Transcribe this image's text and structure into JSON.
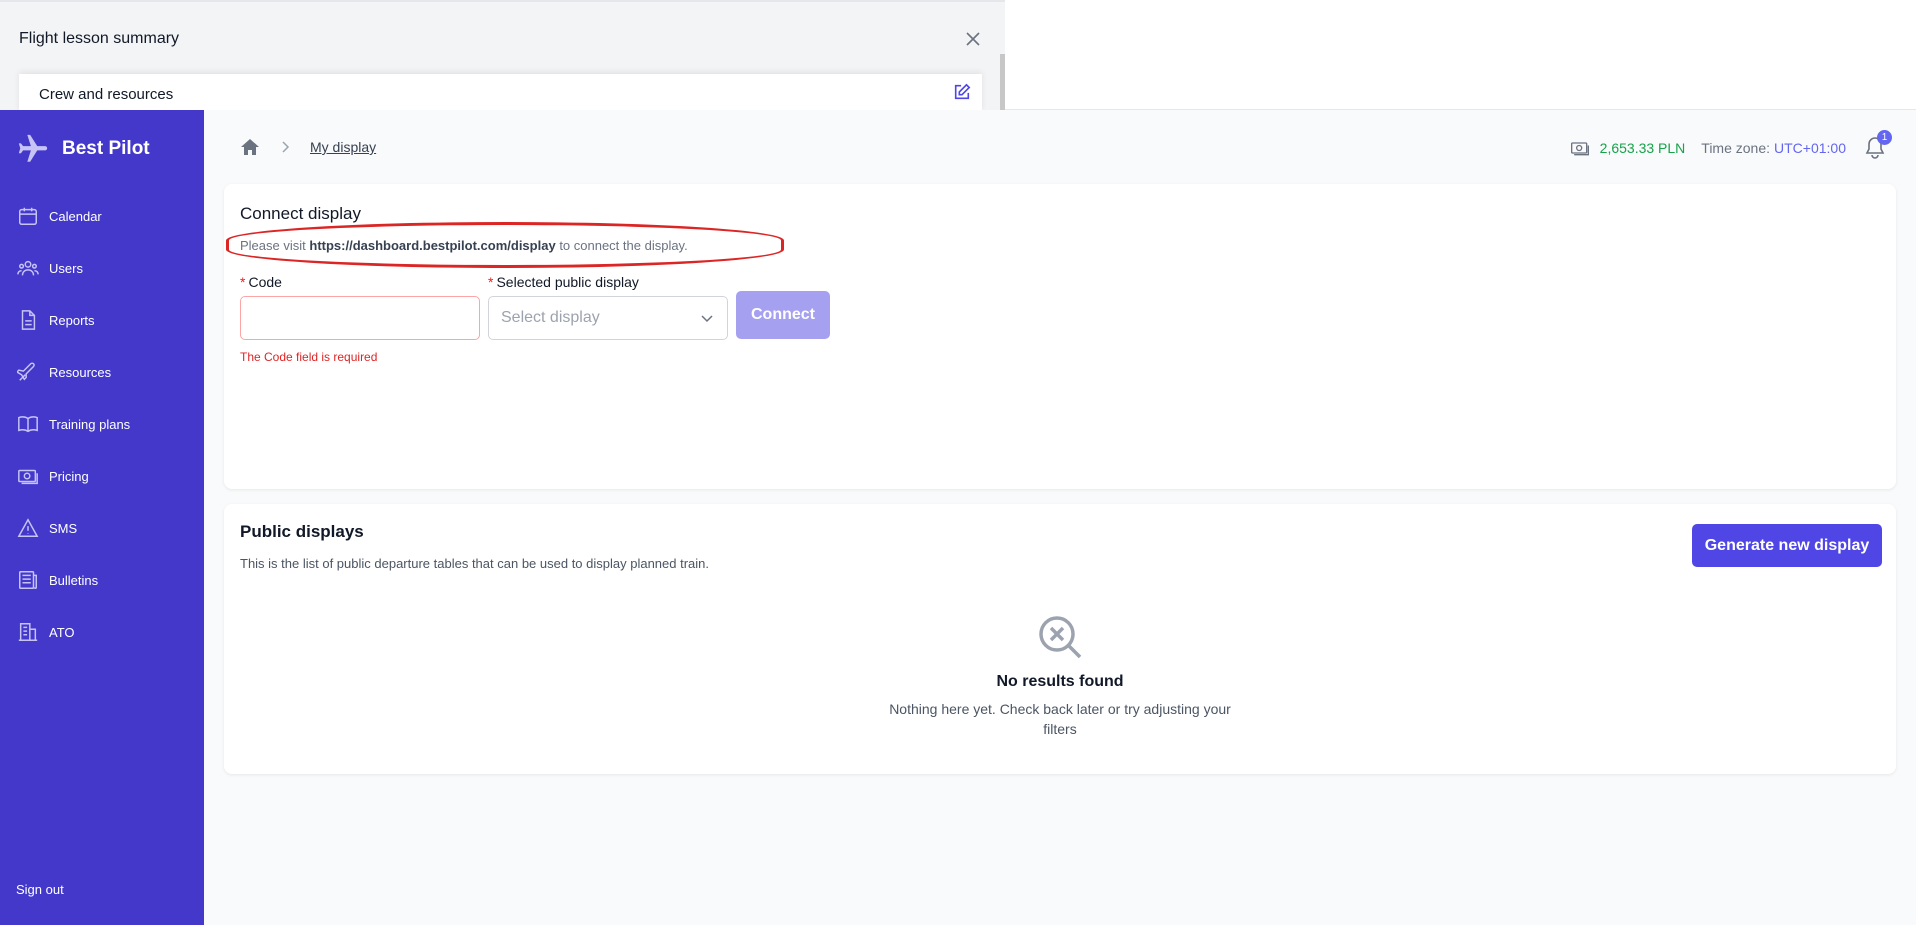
{
  "overlay": {
    "title": "Flight lesson summary",
    "row_label": "Crew and resources"
  },
  "brand": {
    "name": "Best Pilot"
  },
  "sidebar": {
    "items": [
      {
        "label": "Calendar",
        "icon": "calendar-icon"
      },
      {
        "label": "Users",
        "icon": "users-icon"
      },
      {
        "label": "Reports",
        "icon": "document-icon"
      },
      {
        "label": "Resources",
        "icon": "plane-icon"
      },
      {
        "label": "Training plans",
        "icon": "book-icon"
      },
      {
        "label": "Pricing",
        "icon": "cash-icon"
      },
      {
        "label": "SMS",
        "icon": "warning-icon"
      },
      {
        "label": "Bulletins",
        "icon": "newspaper-icon"
      },
      {
        "label": "ATO",
        "icon": "building-icon"
      }
    ],
    "signout": "Sign out"
  },
  "breadcrumb": {
    "current": "My display"
  },
  "header": {
    "balance": "2,653.33 PLN",
    "tz_label": "Time zone:",
    "tz_value": "UTC+01:00",
    "notifications": "1"
  },
  "connect": {
    "title": "Connect display",
    "info_prefix": "Please visit",
    "info_url": "https://dashboard.bestpilot.com/display",
    "info_suffix": "to connect the display.",
    "code_label": "Code",
    "code_error": "The Code field is required",
    "display_label": "Selected public display",
    "display_placeholder": "Select display",
    "connect_button": "Connect",
    "required_mark": "*"
  },
  "public": {
    "title": "Public displays",
    "subtitle": "This is the list of public departure tables that can be used to display planned train.",
    "generate_button": "Generate new display",
    "empty_title": "No results found",
    "empty_desc": "Nothing here yet. Check back later or try adjusting your filters"
  },
  "colors": {
    "sidebar": "#4338ca",
    "primary": "#4f46e5",
    "highlight": "#dc2626"
  }
}
